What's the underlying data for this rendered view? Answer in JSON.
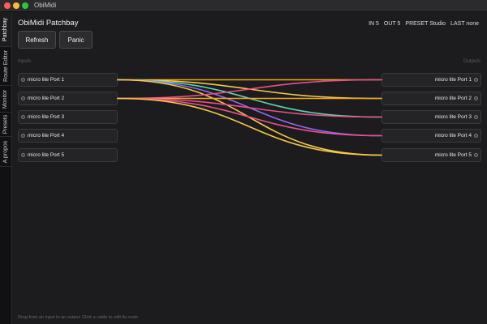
{
  "window": {
    "title": "ObiMidi"
  },
  "sidebar": {
    "tabs": [
      {
        "label": "Patchbay",
        "active": true
      },
      {
        "label": "Route Editor",
        "active": false
      },
      {
        "label": "Monitor",
        "active": false
      },
      {
        "label": "Presets",
        "active": false
      },
      {
        "label": "A propos",
        "active": false
      }
    ]
  },
  "header": {
    "title": "ObiMidi Patchbay",
    "refresh_label": "Refresh",
    "panic_label": "Panic"
  },
  "status": {
    "in": "IN 5",
    "out": "OUT 5",
    "preset": "PRESET Studio",
    "last": "LAST none"
  },
  "inputs": {
    "label": "Inputs",
    "ports": [
      "micro lite Port 1",
      "micro lite Port 2",
      "micro lite Port 3",
      "micro lite Port 4",
      "micro lite Port 5"
    ]
  },
  "outputs": {
    "label": "Outputs",
    "ports": [
      "micro lite Port 1",
      "micro lite Port 2",
      "micro lite Port 3",
      "micro lite Port 4",
      "micro lite Port 5"
    ]
  },
  "colors": {
    "cable_orange": "#f5a623",
    "cable_yellow": "#f7c948",
    "cable_pink": "#e8508a",
    "cable_purple": "#8a6cf0",
    "cable_teal": "#5ed3b0"
  },
  "routes": [
    {
      "from": 1,
      "to": 1,
      "color": "#f5a623"
    },
    {
      "from": 1,
      "to": 2,
      "color": "#f7c948"
    },
    {
      "from": 1,
      "to": 3,
      "color": "#5ed3b0"
    },
    {
      "from": 1,
      "to": 4,
      "color": "#8a6cf0"
    },
    {
      "from": 1,
      "to": 5,
      "color": "#f7c948"
    },
    {
      "from": 2,
      "to": 1,
      "color": "#e8508a"
    },
    {
      "from": 2,
      "to": 2,
      "color": "#f5a623"
    },
    {
      "from": 2,
      "to": 3,
      "color": "#e8508a"
    },
    {
      "from": 2,
      "to": 4,
      "color": "#e8508a"
    },
    {
      "from": 2,
      "to": 5,
      "color": "#f7c948"
    }
  ],
  "footer": {
    "hint": "Drag from an input to an output. Click a cable to edit its route."
  }
}
